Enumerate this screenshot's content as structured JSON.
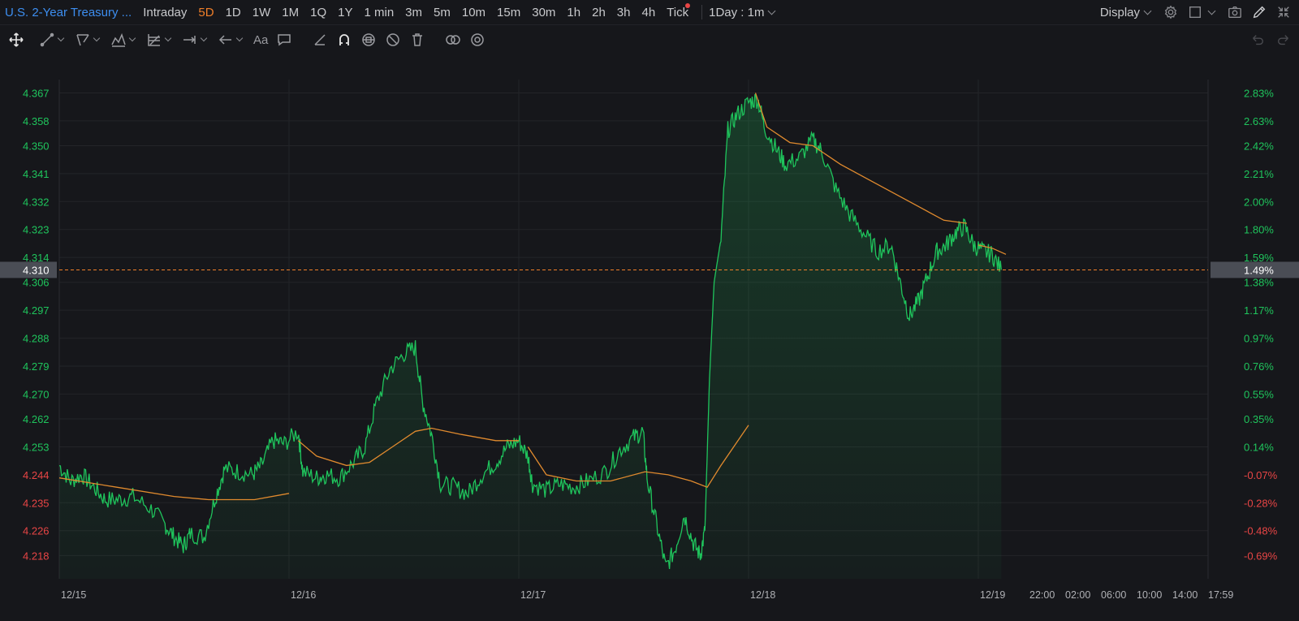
{
  "header": {
    "title": "U.S. 2-Year Treasury ...",
    "periods": [
      {
        "label": "Intraday",
        "active": false
      },
      {
        "label": "5D",
        "active": true
      },
      {
        "label": "1D",
        "active": false
      },
      {
        "label": "1W",
        "active": false
      },
      {
        "label": "1M",
        "active": false
      },
      {
        "label": "1Q",
        "active": false
      },
      {
        "label": "1Y",
        "active": false
      },
      {
        "label": "1 min",
        "active": false
      },
      {
        "label": "3m",
        "active": false
      },
      {
        "label": "5m",
        "active": false
      },
      {
        "label": "10m",
        "active": false
      },
      {
        "label": "15m",
        "active": false
      },
      {
        "label": "30m",
        "active": false
      },
      {
        "label": "1h",
        "active": false
      },
      {
        "label": "2h",
        "active": false
      },
      {
        "label": "3h",
        "active": false
      },
      {
        "label": "4h",
        "active": false
      },
      {
        "label": "Tick",
        "active": false,
        "dot": true
      }
    ],
    "interval_label": "1Day : 1m",
    "display_label": "Display"
  },
  "toolbar": {
    "text_tool_label": "Aa"
  },
  "colors": {
    "accent": "#f07f2a",
    "up": "#1fc45c",
    "down": "#e84545",
    "ma": "#e08a2e",
    "title": "#3d8ef0"
  },
  "chart_data": {
    "type": "area",
    "title": "",
    "y_left_ticks": [
      "4.367",
      "4.358",
      "4.350",
      "4.341",
      "4.332",
      "4.323",
      "4.314",
      "4.306",
      "4.297",
      "4.288",
      "4.279",
      "4.270",
      "4.262",
      "4.253",
      "4.244",
      "4.235",
      "4.226",
      "4.218"
    ],
    "y_right_ticks": [
      "2.83%",
      "2.63%",
      "2.42%",
      "2.21%",
      "2.00%",
      "1.80%",
      "1.59%",
      "1.38%",
      "1.17%",
      "0.97%",
      "0.76%",
      "0.55%",
      "0.35%",
      "0.14%",
      "-0.07%",
      "-0.28%",
      "-0.48%",
      "-0.69%"
    ],
    "ylim": [
      4.2105,
      4.3713
    ],
    "x_labels": [
      "12/15",
      "12/16",
      "12/17",
      "12/18",
      "12/19",
      "22:00",
      "02:00",
      "06:00",
      "10:00",
      "14:00",
      "17:59"
    ],
    "prev_close": 4.247,
    "current": {
      "price": "4.310",
      "percent": "1.49%"
    },
    "price_series": [
      {
        "t": 0.0,
        "v": 4.247
      },
      {
        "t": 0.05,
        "v": 4.242
      },
      {
        "t": 0.1,
        "v": 4.244
      },
      {
        "t": 0.15,
        "v": 4.24
      },
      {
        "t": 0.2,
        "v": 4.236
      },
      {
        "t": 0.26,
        "v": 4.236
      },
      {
        "t": 0.32,
        "v": 4.237
      },
      {
        "t": 0.4,
        "v": 4.233
      },
      {
        "t": 0.46,
        "v": 4.228
      },
      {
        "t": 0.5,
        "v": 4.224
      },
      {
        "t": 0.54,
        "v": 4.221
      },
      {
        "t": 0.57,
        "v": 4.225
      },
      {
        "t": 0.63,
        "v": 4.224
      },
      {
        "t": 0.68,
        "v": 4.237
      },
      {
        "t": 0.72,
        "v": 4.246
      },
      {
        "t": 0.78,
        "v": 4.245
      },
      {
        "t": 0.84,
        "v": 4.244
      },
      {
        "t": 0.88,
        "v": 4.247
      },
      {
        "t": 0.93,
        "v": 4.255
      },
      {
        "t": 0.98,
        "v": 4.254
      },
      {
        "t": 1.04,
        "v": 4.258
      },
      {
        "t": 1.06,
        "v": 4.245
      },
      {
        "t": 1.12,
        "v": 4.243
      },
      {
        "t": 1.16,
        "v": 4.244
      },
      {
        "t": 1.22,
        "v": 4.243
      },
      {
        "t": 1.28,
        "v": 4.248
      },
      {
        "t": 1.33,
        "v": 4.253
      },
      {
        "t": 1.38,
        "v": 4.267
      },
      {
        "t": 1.44,
        "v": 4.278
      },
      {
        "t": 1.5,
        "v": 4.283
      },
      {
        "t": 1.55,
        "v": 4.285
      },
      {
        "t": 1.58,
        "v": 4.268
      },
      {
        "t": 1.62,
        "v": 4.257
      },
      {
        "t": 1.66,
        "v": 4.241
      },
      {
        "t": 1.72,
        "v": 4.24
      },
      {
        "t": 1.78,
        "v": 4.238
      },
      {
        "t": 1.84,
        "v": 4.244
      },
      {
        "t": 1.9,
        "v": 4.248
      },
      {
        "t": 1.95,
        "v": 4.253
      },
      {
        "t": 2.0,
        "v": 4.255
      },
      {
        "t": 2.04,
        "v": 4.25
      },
      {
        "t": 2.06,
        "v": 4.241
      },
      {
        "t": 2.12,
        "v": 4.239
      },
      {
        "t": 2.18,
        "v": 4.241
      },
      {
        "t": 2.24,
        "v": 4.24
      },
      {
        "t": 2.3,
        "v": 4.242
      },
      {
        "t": 2.38,
        "v": 4.245
      },
      {
        "t": 2.44,
        "v": 4.252
      },
      {
        "t": 2.5,
        "v": 4.256
      },
      {
        "t": 2.54,
        "v": 4.258
      },
      {
        "t": 2.56,
        "v": 4.242
      },
      {
        "t": 2.6,
        "v": 4.228
      },
      {
        "t": 2.64,
        "v": 4.214
      },
      {
        "t": 2.68,
        "v": 4.22
      },
      {
        "t": 2.72,
        "v": 4.231
      },
      {
        "t": 2.76,
        "v": 4.222
      },
      {
        "t": 2.79,
        "v": 4.218
      },
      {
        "t": 2.81,
        "v": 4.226
      },
      {
        "t": 2.83,
        "v": 4.275
      },
      {
        "t": 2.85,
        "v": 4.306
      },
      {
        "t": 2.88,
        "v": 4.32
      },
      {
        "t": 2.91,
        "v": 4.355
      },
      {
        "t": 2.95,
        "v": 4.36
      },
      {
        "t": 3.0,
        "v": 4.364
      },
      {
        "t": 3.04,
        "v": 4.365
      },
      {
        "t": 3.07,
        "v": 4.356
      },
      {
        "t": 3.12,
        "v": 4.349
      },
      {
        "t": 3.16,
        "v": 4.344
      },
      {
        "t": 3.22,
        "v": 4.346
      },
      {
        "t": 3.28,
        "v": 4.352
      },
      {
        "t": 3.32,
        "v": 4.348
      },
      {
        "t": 3.38,
        "v": 4.336
      },
      {
        "t": 3.44,
        "v": 4.328
      },
      {
        "t": 3.5,
        "v": 4.322
      },
      {
        "t": 3.56,
        "v": 4.316
      },
      {
        "t": 3.62,
        "v": 4.318
      },
      {
        "t": 3.66,
        "v": 4.306
      },
      {
        "t": 3.7,
        "v": 4.295
      },
      {
        "t": 3.74,
        "v": 4.3
      },
      {
        "t": 3.78,
        "v": 4.308
      },
      {
        "t": 3.82,
        "v": 4.316
      },
      {
        "t": 3.86,
        "v": 4.318
      },
      {
        "t": 3.9,
        "v": 4.322
      },
      {
        "t": 3.94,
        "v": 4.324
      },
      {
        "t": 3.98,
        "v": 4.318
      },
      {
        "t": 4.02,
        "v": 4.316
      },
      {
        "t": 4.06,
        "v": 4.315
      },
      {
        "t": 4.1,
        "v": 4.31
      }
    ],
    "ma_series": [
      [
        {
          "t": 0.0,
          "v": 4.243
        },
        {
          "t": 0.25,
          "v": 4.24
        },
        {
          "t": 0.5,
          "v": 4.237
        },
        {
          "t": 0.65,
          "v": 4.236
        },
        {
          "t": 0.85,
          "v": 4.236
        },
        {
          "t": 1.0,
          "v": 4.238
        }
      ],
      [
        {
          "t": 1.04,
          "v": 4.255
        },
        {
          "t": 1.12,
          "v": 4.25
        },
        {
          "t": 1.25,
          "v": 4.247
        },
        {
          "t": 1.35,
          "v": 4.248
        },
        {
          "t": 1.45,
          "v": 4.253
        },
        {
          "t": 1.55,
          "v": 4.258
        },
        {
          "t": 1.62,
          "v": 4.259
        },
        {
          "t": 1.75,
          "v": 4.257
        },
        {
          "t": 1.9,
          "v": 4.255
        },
        {
          "t": 2.0,
          "v": 4.255
        }
      ],
      [
        {
          "t": 2.04,
          "v": 4.253
        },
        {
          "t": 2.12,
          "v": 4.244
        },
        {
          "t": 2.25,
          "v": 4.242
        },
        {
          "t": 2.4,
          "v": 4.242
        },
        {
          "t": 2.55,
          "v": 4.245
        },
        {
          "t": 2.65,
          "v": 4.244
        },
        {
          "t": 2.75,
          "v": 4.242
        },
        {
          "t": 2.82,
          "v": 4.24
        },
        {
          "t": 2.88,
          "v": 4.247
        },
        {
          "t": 3.0,
          "v": 4.26
        }
      ],
      [
        {
          "t": 3.03,
          "v": 4.367
        },
        {
          "t": 3.08,
          "v": 4.356
        },
        {
          "t": 3.18,
          "v": 4.351
        },
        {
          "t": 3.28,
          "v": 4.35
        },
        {
          "t": 3.4,
          "v": 4.344
        },
        {
          "t": 3.55,
          "v": 4.338
        },
        {
          "t": 3.7,
          "v": 4.332
        },
        {
          "t": 3.85,
          "v": 4.326
        },
        {
          "t": 3.95,
          "v": 4.325
        }
      ],
      [
        {
          "t": 4.0,
          "v": 4.318
        },
        {
          "t": 4.06,
          "v": 4.317
        },
        {
          "t": 4.12,
          "v": 4.315
        }
      ]
    ]
  }
}
